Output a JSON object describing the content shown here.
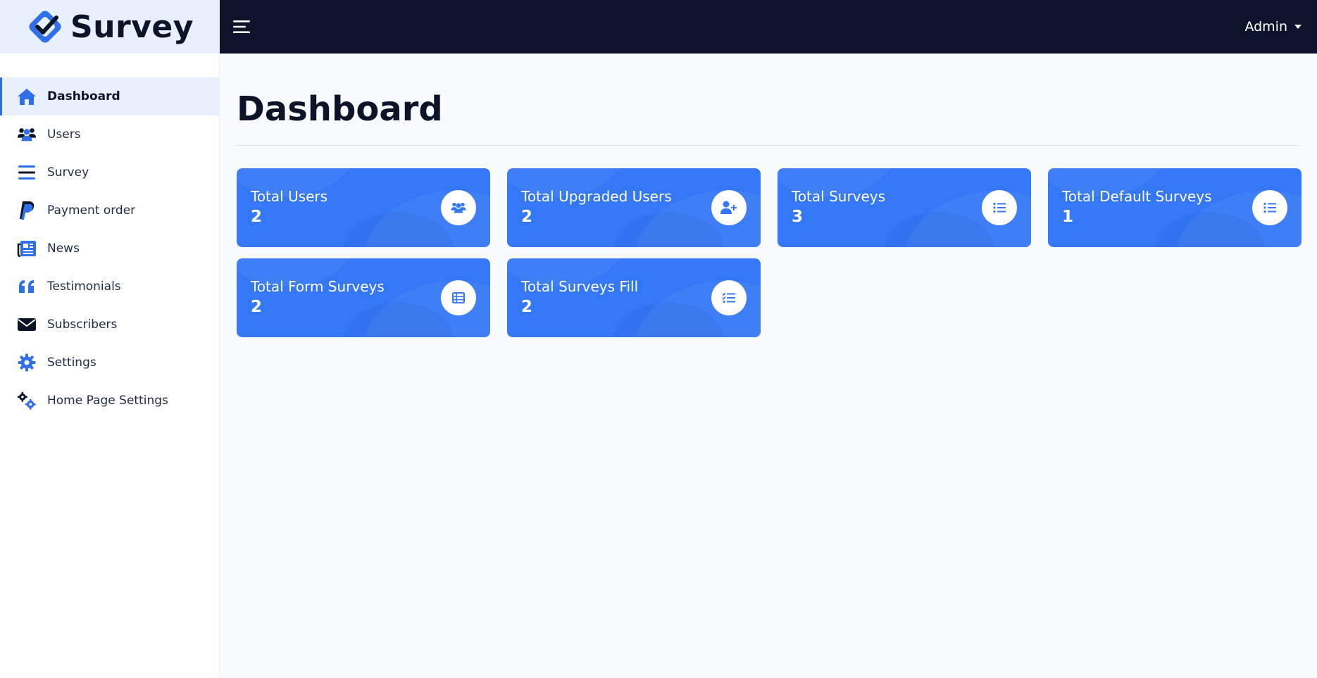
{
  "brand": {
    "name": "Survey"
  },
  "topbar": {
    "user_label": "Admin"
  },
  "sidebar": {
    "items": [
      {
        "label": "Dashboard",
        "icon": "home-icon",
        "active": true
      },
      {
        "label": "Users",
        "icon": "users-icon"
      },
      {
        "label": "Survey",
        "icon": "bars-icon"
      },
      {
        "label": "Payment order",
        "icon": "paypal-icon"
      },
      {
        "label": "News",
        "icon": "newspaper-icon"
      },
      {
        "label": "Testimonials",
        "icon": "quote-icon"
      },
      {
        "label": "Subscribers",
        "icon": "envelope-icon"
      },
      {
        "label": "Settings",
        "icon": "gear-icon"
      },
      {
        "label": "Home Page Settings",
        "icon": "gears-icon"
      }
    ]
  },
  "main": {
    "title": "Dashboard",
    "cards": [
      {
        "title": "Total Users",
        "value": "2",
        "icon": "users-icon"
      },
      {
        "title": "Total Upgraded Users",
        "value": "2",
        "icon": "user-plus-icon"
      },
      {
        "title": "Total Surveys",
        "value": "3",
        "icon": "list-icon"
      },
      {
        "title": "Total Default Surveys",
        "value": "1",
        "icon": "list-icon"
      },
      {
        "title": "Total Form Surveys",
        "value": "2",
        "icon": "table-list-icon"
      },
      {
        "title": "Total Surveys Fill",
        "value": "2",
        "icon": "list-check-icon"
      }
    ]
  },
  "colors": {
    "accent": "#3478f6",
    "topbar_bg": "#0c132b",
    "sidebar_active_bg": "#e8f0fe",
    "page_bg": "#f8fafd"
  }
}
